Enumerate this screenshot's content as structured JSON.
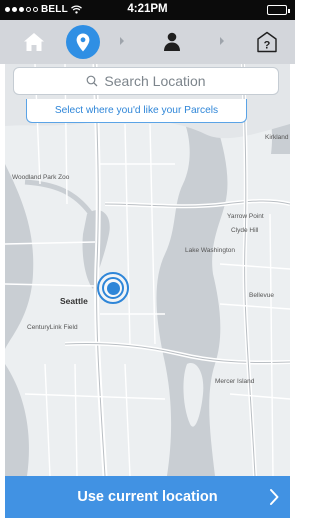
{
  "status_bar": {
    "carrier": "BELL",
    "time": "4:21PM"
  },
  "step_nav": {
    "steps": [
      {
        "icon": "home-icon"
      },
      {
        "icon": "location-pin-icon",
        "active": true
      },
      {
        "icon": "user-icon"
      },
      {
        "icon": "help-icon"
      }
    ],
    "accent_color": "#2f8fe4"
  },
  "search": {
    "placeholder": "Search Location"
  },
  "hint": {
    "text": "Select where you'd like your Parcels"
  },
  "map": {
    "labels": {
      "seattle": "Seattle",
      "kirkland": "Kirkland",
      "woodland_park_zoo": "Woodland Park Zoo",
      "yarrow_point": "Yarrow Point",
      "clyde_hill": "Clyde Hill",
      "lake_washington": "Lake Washington",
      "bellevue": "Bellevue",
      "centurylink_field": "CenturyLink Field",
      "mercer_island": "Mercer Island"
    }
  },
  "cta": {
    "label": "Use current location",
    "color": "#4192e3"
  }
}
